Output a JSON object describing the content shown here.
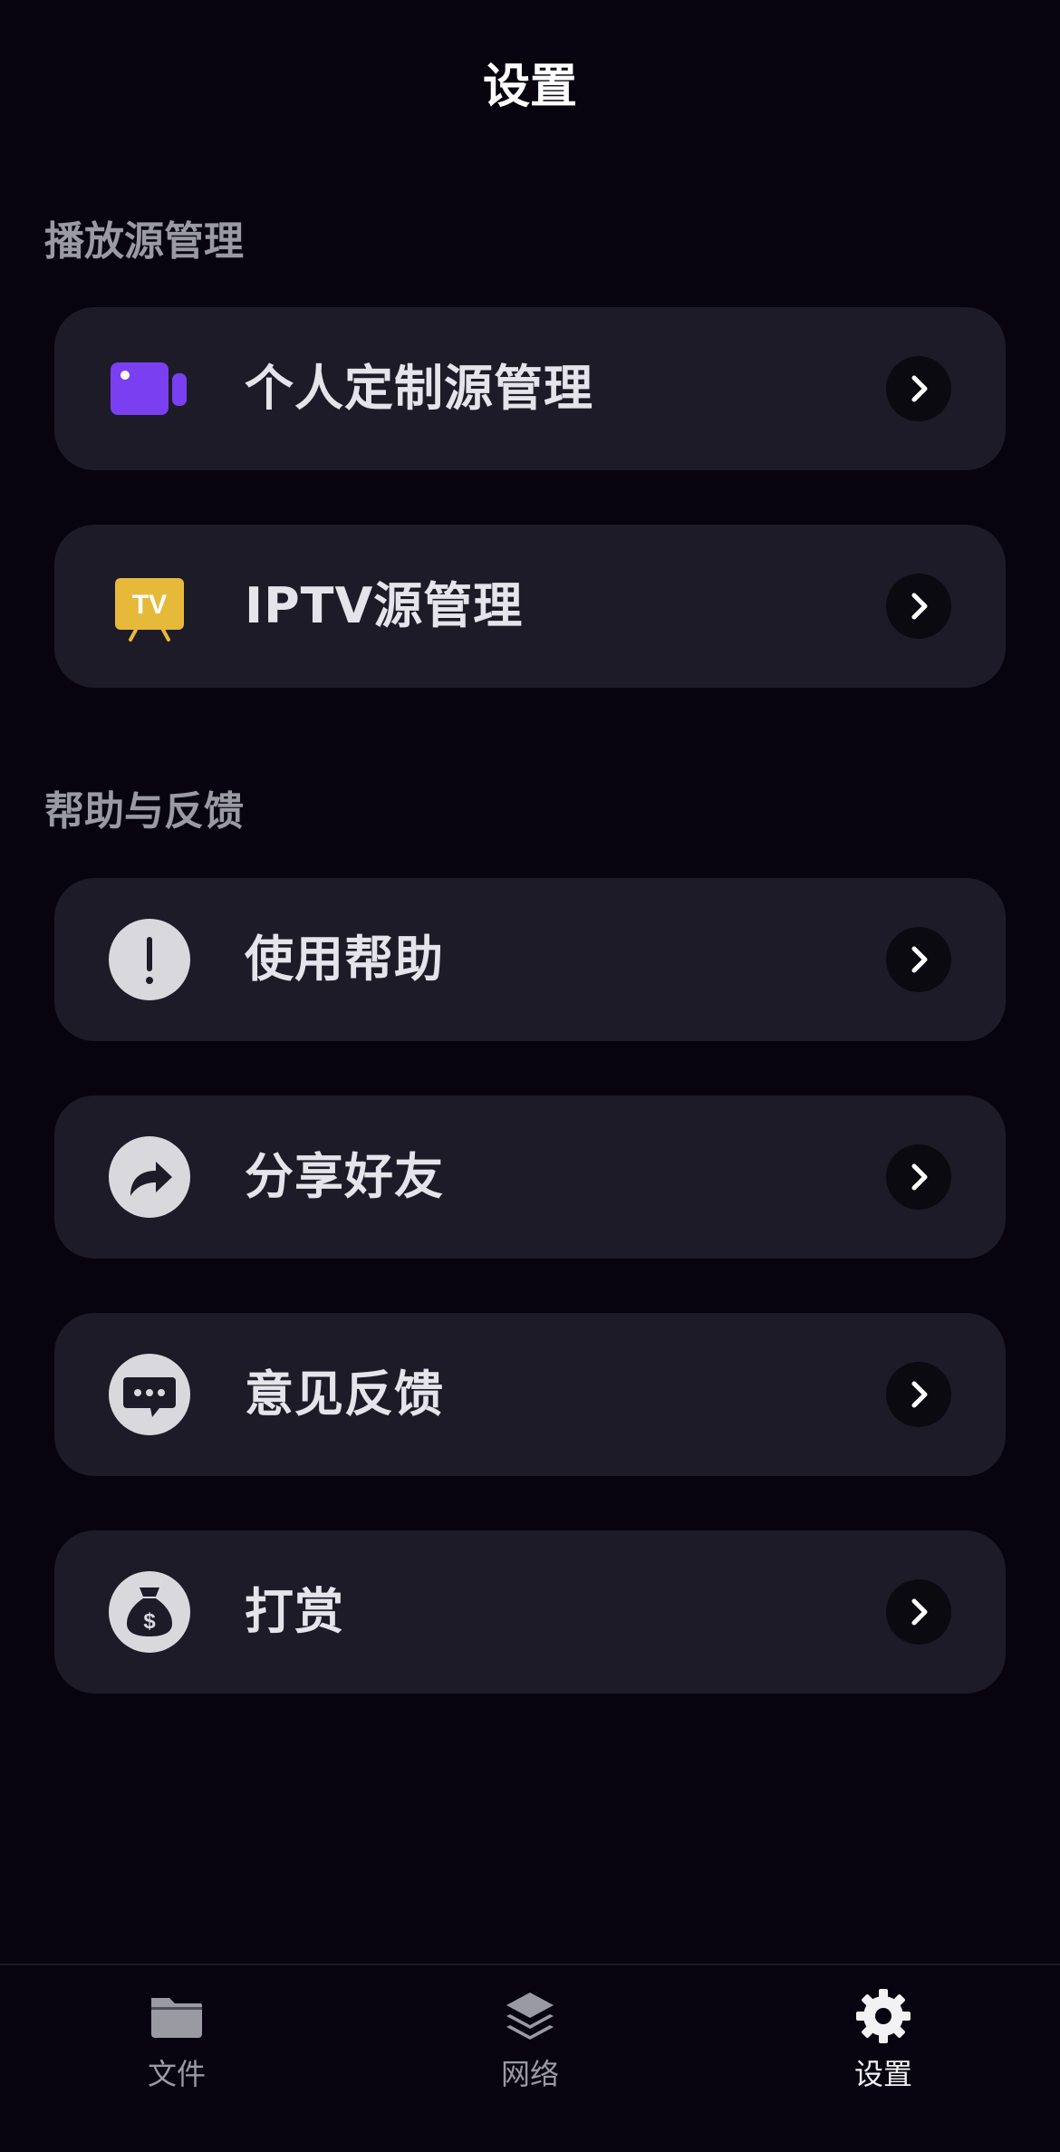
{
  "header": {
    "title": "设置"
  },
  "sections": {
    "source": {
      "title": "播放源管理",
      "items": [
        {
          "label": "个人定制源管理",
          "icon": "video-camera-icon"
        },
        {
          "label": "IPTV源管理",
          "icon": "tv-icon",
          "icon_text": "TV"
        }
      ]
    },
    "help": {
      "title": "帮助与反馈",
      "items": [
        {
          "label": "使用帮助",
          "icon": "exclamation-icon"
        },
        {
          "label": "分享好友",
          "icon": "share-arrow-icon"
        },
        {
          "label": "意见反馈",
          "icon": "chat-bubble-icon"
        },
        {
          "label": "打赏",
          "icon": "money-bag-icon"
        }
      ]
    }
  },
  "tabbar": {
    "tabs": [
      {
        "label": "文件",
        "icon": "folder-icon",
        "active": false
      },
      {
        "label": "网络",
        "icon": "layers-icon",
        "active": false
      },
      {
        "label": "设置",
        "icon": "gear-icon",
        "active": true
      }
    ]
  },
  "colors": {
    "background": "#07040f",
    "card": "#1d1b28",
    "video_icon": "#7a3ff0",
    "tv_icon": "#e7b93a",
    "muted_text": "#9a9aa3"
  }
}
